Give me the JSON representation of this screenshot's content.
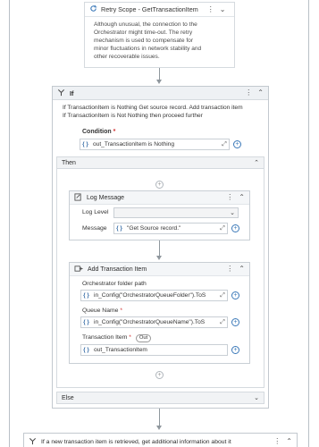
{
  "retry_scope": {
    "title": "Retry Scope - GetTransactionItem",
    "description_lines": [
      "Although unusual, the connection to the",
      "Orchestrator might time-out. The retry",
      "mechanism is used to compensate for",
      "minor fluctuations in network stability and",
      "other recoverable issues."
    ]
  },
  "if_activity": {
    "title": "If",
    "description_lines": [
      "If TransactionItem is Nothing Get source record. Add transaction item",
      "If TransactionItem is Not Nothing then proceed further"
    ],
    "condition_label": "Condition",
    "condition_required": "*",
    "condition_value": "out_TransactionItem is Nothing",
    "then_label": "Then",
    "else_label": "Else"
  },
  "log_message": {
    "title": "Log Message",
    "log_level_label": "Log Level",
    "log_level_value": "",
    "message_label": "Message",
    "message_value": "\"Get Source record.\""
  },
  "add_transaction": {
    "title": "Add Transaction Item",
    "folder_label": "Orchestrator folder path",
    "folder_value": "in_Config(\"OrchestratorQueueFolder\").ToS",
    "queue_label": "Queue Name",
    "queue_required": "*",
    "queue_value": "in_Config(\"OrchestratorQueueName\").ToS",
    "item_label": "Transaction Item",
    "item_required": "*",
    "item_badge": "Out",
    "item_value": "out_TransactionItem"
  },
  "next_activity": {
    "title": "If a new transaction item is retrieved, get additional information about it"
  },
  "icons": {
    "expression": "{ }",
    "expand": "⤢",
    "add": "+",
    "kebab": "⋮",
    "collapse": "⌃",
    "expand_down": "⌄"
  }
}
